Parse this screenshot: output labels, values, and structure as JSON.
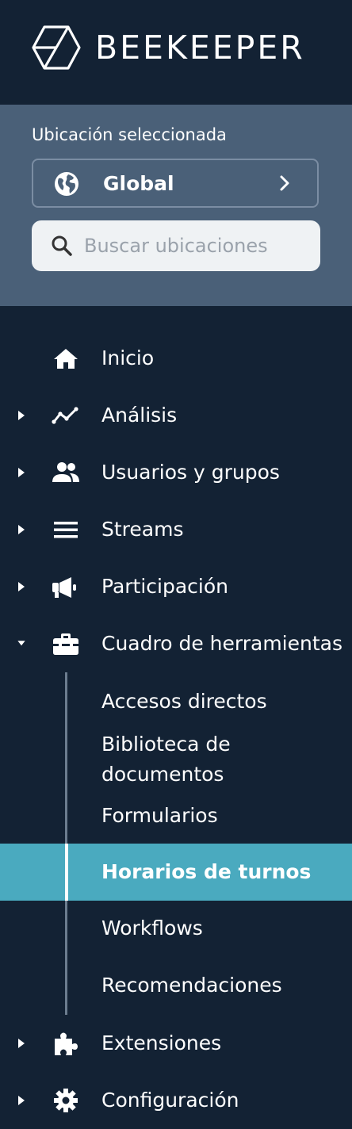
{
  "brand": {
    "name": "BEEKEEPER"
  },
  "location": {
    "label": "Ubicación seleccionada",
    "selected": "Global",
    "search_placeholder": "Buscar ubicaciones"
  },
  "nav": [
    {
      "label": "Inicio",
      "icon": "home-icon",
      "expandable": false
    },
    {
      "label": "Análisis",
      "icon": "analytics-icon",
      "expandable": true
    },
    {
      "label": "Usuarios y grupos",
      "icon": "users-icon",
      "expandable": true
    },
    {
      "label": "Streams",
      "icon": "streams-icon",
      "expandable": true
    },
    {
      "label": "Participación",
      "icon": "megaphone-icon",
      "expandable": true
    },
    {
      "label": "Cuadro de herramientas",
      "icon": "toolbox-icon",
      "expandable": true,
      "expanded": true
    },
    {
      "label": "Extensiones",
      "icon": "puzzle-icon",
      "expandable": true
    },
    {
      "label": "Configuración",
      "icon": "gear-icon",
      "expandable": true
    }
  ],
  "toolbox_items": [
    {
      "label": "Accesos directos"
    },
    {
      "label": "Biblioteca de documentos"
    },
    {
      "label": "Formularios"
    },
    {
      "label": "Horarios de turnos",
      "active": true
    },
    {
      "label": "Workflows"
    },
    {
      "label": "Recomendaciones"
    }
  ],
  "colors": {
    "sidebar_bg": "#132234",
    "location_panel_bg": "#4a6078",
    "active_item_bg": "#4aaabf",
    "search_bg": "#eff2f4"
  }
}
